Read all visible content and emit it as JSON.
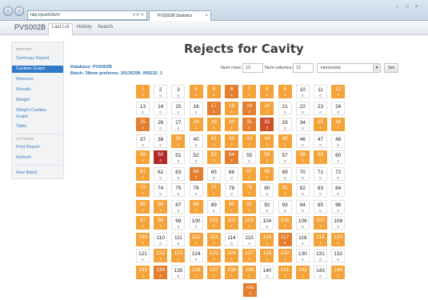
{
  "browser": {
    "address": "http://pvs002b/#/",
    "tab_title": "PVS002B Statistics",
    "back_icon": "back-arrow-icon",
    "forward_icon": "forward-arrow-icon",
    "close_glyph": "×",
    "window_controls": [
      "–",
      "□",
      "×"
    ]
  },
  "app": {
    "brand": "PVS002B",
    "nav": [
      "Last Lot",
      "History",
      "Search"
    ],
    "active_nav": "Last Lot"
  },
  "sidebar": {
    "sections": [
      {
        "label": "REPORT",
        "items": [
          "Summary Report",
          "Cavities Graph",
          "Measure",
          "Results",
          "Weight",
          "Weight Cavities Graph",
          "Table"
        ]
      },
      {
        "label": "ACTIONS",
        "items": [
          "Print Report",
          "Refresh"
        ]
      },
      {
        "label": "",
        "items": [
          "New Batch"
        ]
      }
    ],
    "active_item": "Cavities Graph"
  },
  "main": {
    "title": "Rejects for Cavity",
    "database_label": "Database: PVS002B",
    "batch_label": "Batch: 38mm preforms_20130308_090232_1"
  },
  "controls": {
    "rows_label": "Num rows:",
    "rows_value": "12",
    "cols_label": "Num columns:",
    "cols_value": "12",
    "orientation": "Horizontal",
    "set_label": "Set"
  },
  "colors": {
    "level0": "#ffffff",
    "level1": "#f5a339",
    "level2": "#e47d2e",
    "level3": "#cf4f24",
    "level4": "#b12a2a"
  },
  "cavities": {
    "levels": [
      1,
      0,
      0,
      1,
      1,
      2,
      1,
      1,
      1,
      0,
      0,
      1,
      0,
      0,
      0,
      0,
      2,
      1,
      2,
      1,
      0,
      0,
      0,
      0,
      2,
      0,
      0,
      1,
      1,
      1,
      2,
      3,
      0,
      0,
      1,
      1,
      0,
      0,
      1,
      0,
      1,
      1,
      1,
      1,
      1,
      0,
      0,
      0,
      1,
      4,
      0,
      0,
      1,
      2,
      0,
      1,
      0,
      1,
      1,
      0,
      1,
      0,
      0,
      2,
      0,
      0,
      1,
      1,
      0,
      0,
      0,
      0,
      1,
      0,
      0,
      0,
      1,
      0,
      1,
      0,
      1,
      0,
      0,
      0,
      1,
      1,
      0,
      1,
      0,
      1,
      1,
      0,
      0,
      0,
      0,
      0,
      1,
      1,
      0,
      0,
      1,
      1,
      1,
      0,
      1,
      0,
      1,
      0,
      1,
      0,
      0,
      1,
      1,
      0,
      0,
      1,
      2,
      0,
      1,
      1,
      0,
      1,
      1,
      0,
      1,
      1,
      1,
      1,
      1,
      0,
      0,
      0,
      1,
      2,
      0,
      1,
      1,
      1,
      1,
      0,
      1,
      1,
      0,
      1
    ],
    "counts": [
      "1",
      "0",
      "0",
      "1",
      "1",
      "2",
      "1",
      "1",
      "1",
      "0",
      "0",
      "1",
      "0",
      "0",
      "0",
      "0",
      "2",
      "1",
      "2",
      "1",
      "0",
      "0",
      "0",
      "0",
      "2",
      "0",
      "0",
      "1",
      "1",
      "1",
      "2",
      "3",
      "0",
      "0",
      "1",
      "1",
      "0",
      "0",
      "1",
      "0",
      "1",
      "1",
      "1",
      "1",
      "1",
      "0",
      "0",
      "0",
      "1",
      "4",
      "0",
      "0",
      "1",
      "2",
      "0",
      "1",
      "0",
      "1",
      "1",
      "0",
      "1",
      "0",
      "0",
      "2",
      "0",
      "0",
      "1",
      "1",
      "0",
      "0",
      "0",
      "0",
      "1",
      "0",
      "0",
      "0",
      "1",
      "0",
      "1",
      "0",
      "1",
      "0",
      "0",
      "0",
      "1",
      "1",
      "0",
      "1",
      "0",
      "1",
      "1",
      "0",
      "0",
      "0",
      "0",
      "0",
      "1",
      "1",
      "0",
      "0",
      "1",
      "1",
      "1",
      "0",
      "1",
      "0",
      "1",
      "0",
      "1",
      "0",
      "0",
      "1",
      "1",
      "0",
      "0",
      "1",
      "2",
      "0",
      "1",
      "1",
      "0",
      "1",
      "1",
      "0",
      "1",
      "1",
      "1",
      "1",
      "1",
      "0",
      "0",
      "0",
      "1",
      "2",
      "0",
      "1",
      "1",
      "1",
      "1",
      "0",
      "1",
      "1",
      "0",
      "1"
    ],
    "na_label": "n/a",
    "na_count": "2"
  }
}
